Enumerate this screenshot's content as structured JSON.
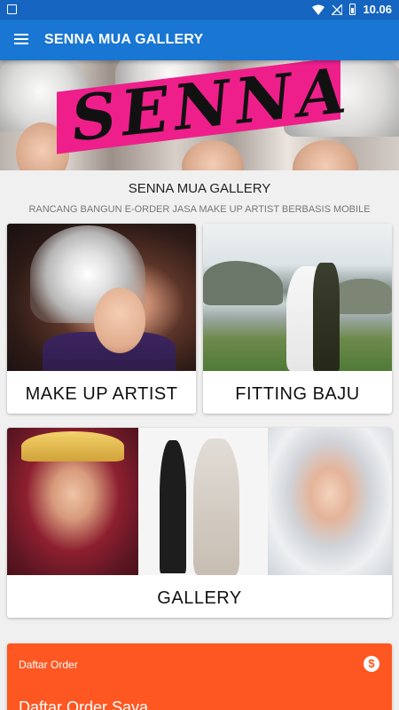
{
  "status_bar": {
    "time": "10.06"
  },
  "app_bar": {
    "title": "SENNA MUA GALLERY"
  },
  "banner": {
    "logo_text": "SENNA"
  },
  "info": {
    "title": "SENNA MUA GALLERY",
    "subtitle": "RANCANG BANGUN E-ORDER JASA MAKE UP ARTIST BERBASIS MOBILE"
  },
  "menu_cards": {
    "make_up_artist": "MAKE  UP ARTIST",
    "fitting_baju": "FITTING BAJU",
    "gallery": "GALLERY"
  },
  "order_card": {
    "small_label": "Daftar Order",
    "title": "Daftar Order Saya"
  },
  "colors": {
    "status_bar": "#1565c0",
    "app_bar": "#1976d2",
    "order_card": "#ff5722",
    "banner_stripe": "#ee1f8b"
  }
}
